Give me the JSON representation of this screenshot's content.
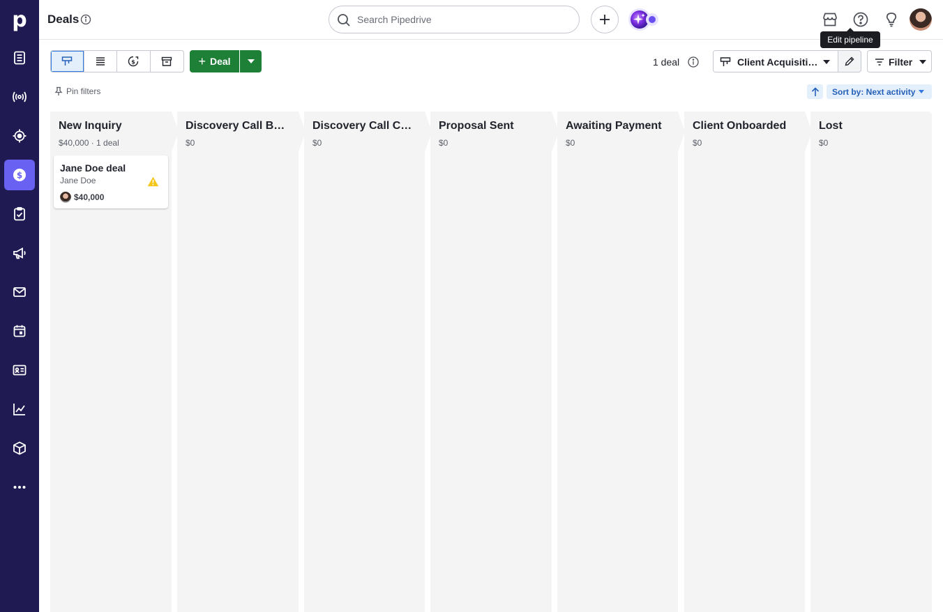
{
  "sidebar": {
    "logo": "p",
    "items": [
      {
        "name": "leads-icon"
      },
      {
        "name": "broadcast-icon"
      },
      {
        "name": "projects-icon"
      },
      {
        "name": "deals-icon"
      },
      {
        "name": "activities-icon"
      },
      {
        "name": "campaigns-icon"
      },
      {
        "name": "mail-icon"
      },
      {
        "name": "calendar-icon"
      },
      {
        "name": "contacts-icon"
      },
      {
        "name": "insights-icon"
      },
      {
        "name": "products-icon"
      },
      {
        "name": "more-icon"
      }
    ]
  },
  "header": {
    "title": "Deals",
    "search_placeholder": "Search Pipedrive",
    "tooltip": "Edit pipeline"
  },
  "toolbar": {
    "deal_label": "Deal",
    "deal_count": "1 deal",
    "pipeline": "Client Acquisition",
    "filter_label": "Filter",
    "pin_filters": "Pin filters",
    "sort_label": "Sort by: Next activity"
  },
  "stages": [
    {
      "title": "New Inquiry",
      "summary": "$40,000 · 1 deal"
    },
    {
      "title": "Discovery Call Booked",
      "summary": "$0"
    },
    {
      "title": "Discovery Call Completed",
      "summary": "$0"
    },
    {
      "title": "Proposal Sent",
      "summary": "$0"
    },
    {
      "title": "Awaiting Payment",
      "summary": "$0"
    },
    {
      "title": "Client Onboarded",
      "summary": "$0"
    },
    {
      "title": "Lost",
      "summary": "$0"
    }
  ],
  "deal_card": {
    "title": "Jane Doe deal",
    "person": "Jane Doe",
    "value": "$40,000"
  },
  "colors": {
    "sidebar": "#1f1a52",
    "active_nav": "#6861f2",
    "primary_green": "#1e8037",
    "link_blue": "#317ae2",
    "stage_bg": "#f4f4f4",
    "warning": "#f5c518"
  }
}
